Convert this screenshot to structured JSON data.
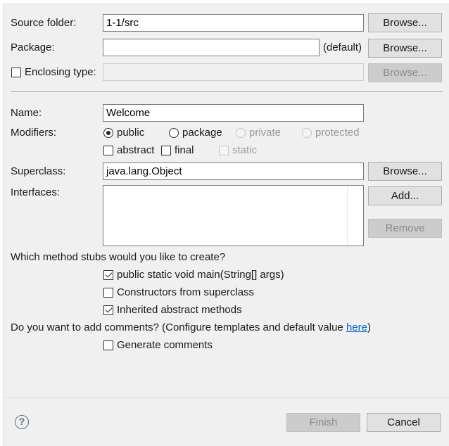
{
  "form": {
    "source_folder": {
      "label": "Source folder:",
      "value": "1-1/src",
      "browse": "Browse..."
    },
    "package": {
      "label": "Package:",
      "value": "",
      "default_hint": "(default)",
      "browse": "Browse..."
    },
    "enclosing_type": {
      "label": "Enclosing type:",
      "checked": false,
      "value": "",
      "browse": "Browse..."
    },
    "name": {
      "label": "Name:",
      "value": "Welcome"
    },
    "modifiers": {
      "label": "Modifiers:",
      "access": [
        {
          "label": "public",
          "selected": true,
          "enabled": true
        },
        {
          "label": "package",
          "selected": false,
          "enabled": true
        },
        {
          "label": "private",
          "selected": false,
          "enabled": false
        },
        {
          "label": "protected",
          "selected": false,
          "enabled": false
        }
      ],
      "flags": [
        {
          "label": "abstract",
          "checked": false,
          "enabled": true
        },
        {
          "label": "final",
          "checked": false,
          "enabled": true
        },
        {
          "label": "static",
          "checked": false,
          "enabled": false
        }
      ]
    },
    "superclass": {
      "label": "Superclass:",
      "value": "java.lang.Object",
      "browse": "Browse..."
    },
    "interfaces": {
      "label": "Interfaces:",
      "add": "Add...",
      "remove": "Remove"
    },
    "stubs": {
      "question": "Which method stubs would you like to create?",
      "options": [
        {
          "label": "public static void main(String[] args)",
          "checked": true
        },
        {
          "label": "Constructors from superclass",
          "checked": false
        },
        {
          "label": "Inherited abstract methods",
          "checked": true
        }
      ]
    },
    "comments": {
      "question_prefix": "Do you want to add comments? (Configure templates and default value ",
      "link": "here",
      "question_suffix": ")",
      "generate": {
        "label": "Generate comments",
        "checked": false
      }
    }
  },
  "footer": {
    "help_icon": "question-mark-icon",
    "help_glyph": "?",
    "finish": "Finish",
    "cancel": "Cancel"
  }
}
